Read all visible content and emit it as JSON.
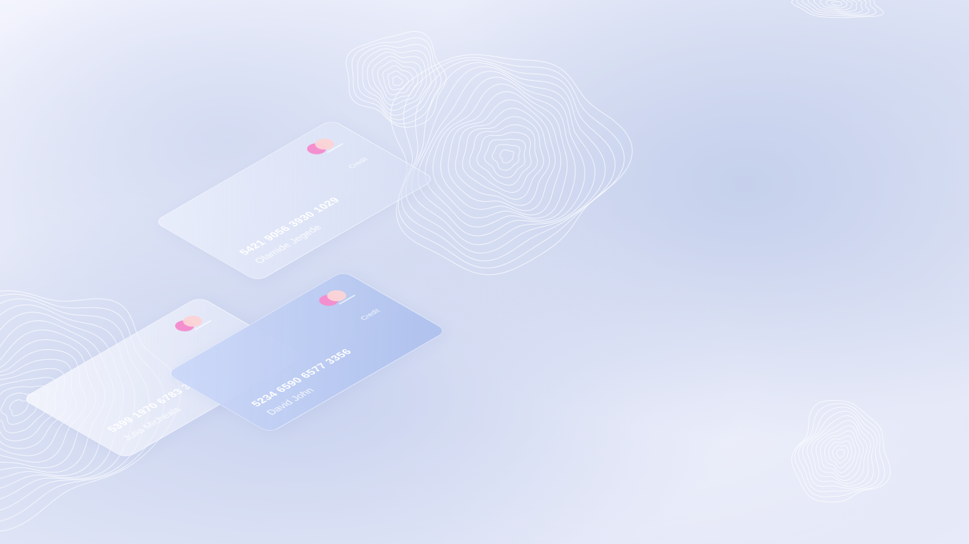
{
  "cards": [
    {
      "type": "Credit",
      "number": "5421 9056 3930 1029",
      "holder": "Olamide Jegede"
    },
    {
      "type": "",
      "number": "5399 1970 6783 3458",
      "holder": "Julia Micheals"
    },
    {
      "type": "Credit",
      "number": "5234 6590 6577 3356",
      "holder": "David John"
    }
  ],
  "colors": {
    "accent_pink": "#f48fcf",
    "accent_peach": "#fbd4d6",
    "card_blue": "#b4c5f0",
    "background": "#dde3f5"
  },
  "icons": [
    "mastercard-style-logo-icon",
    "contour-map-decoration"
  ]
}
